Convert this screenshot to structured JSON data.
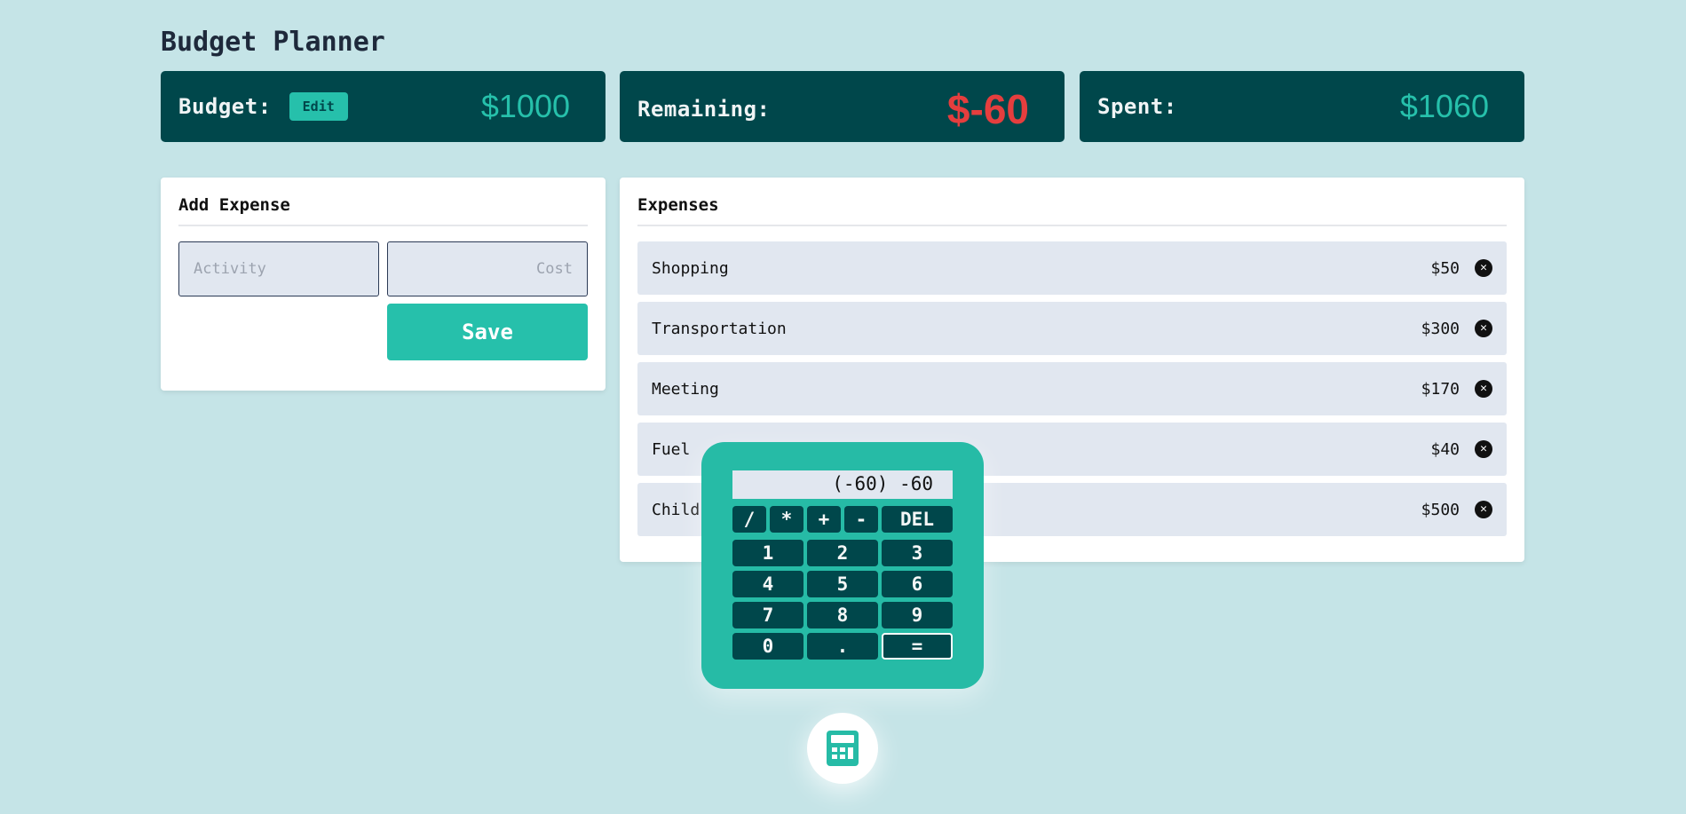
{
  "app": {
    "title": "Budget Planner"
  },
  "summary": {
    "budget": {
      "label": "Budget:",
      "edit_label": "Edit",
      "value": "$1000"
    },
    "remaining": {
      "label": "Remaining:",
      "value": "$-60"
    },
    "spent": {
      "label": "Spent:",
      "value": "$1060"
    }
  },
  "add_expense": {
    "title": "Add Expense",
    "activity_placeholder": "Activity",
    "cost_placeholder": "Cost",
    "save_label": "Save"
  },
  "expenses": {
    "title": "Expenses",
    "items": [
      {
        "name": "Shopping",
        "cost": "$50"
      },
      {
        "name": "Transportation",
        "cost": "$300"
      },
      {
        "name": "Meeting",
        "cost": "$170"
      },
      {
        "name": "Fuel",
        "cost": "$40"
      },
      {
        "name": "Child",
        "cost": "$500"
      }
    ],
    "delete_icon": "close-circle-icon"
  },
  "calculator": {
    "display": "(-60) -60",
    "operators": [
      "/",
      "*",
      "+",
      "-"
    ],
    "del_label": "DEL",
    "keys": [
      "1",
      "2",
      "3",
      "4",
      "5",
      "6",
      "7",
      "8",
      "9",
      "0",
      ".",
      "="
    ]
  },
  "fab": {
    "icon": "calculator-icon"
  },
  "colors": {
    "background": "#c5e4e7",
    "dark_teal": "#00474b",
    "accent": "#26c0ab",
    "negative": "#e53e3e",
    "row_bg": "#e1e7f0"
  }
}
